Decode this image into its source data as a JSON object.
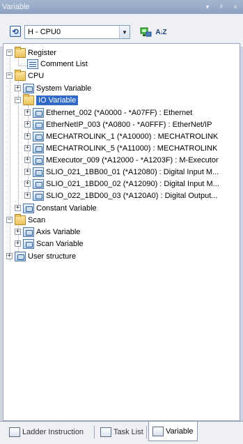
{
  "window": {
    "title": "Variable",
    "pin_glyph": "▾",
    "dock_glyph": "ᵖ",
    "close_glyph": "×"
  },
  "toolbar": {
    "refresh_glyph": "⟲",
    "cpu_select_value": "H - CPU0",
    "dropdown_glyph": "▼",
    "sort_glyph": "A↓Z"
  },
  "tree": {
    "register": "Register",
    "comment_list": "Comment List",
    "cpu": "CPU",
    "system_variable": "System Variable",
    "io_variable": "IO Variable",
    "io_items": [
      "Ethernet_002 (*A0000 - *A07FF) : Ethernet",
      "EtherNetIP_003 (*A0800 - *A0FFF) : EtherNet/IP",
      "MECHATROLINK_1 (*A10000) : MECHATROLINK",
      "MECHATROLINK_5 (*A11000) : MECHATROLINK",
      "MExecutor_009 (*A12000 - *A1203F) : M-Executor",
      "SLIO_021_1BB00_01 (*A12080) : Digital Input M...",
      "SLIO_021_1BD00_02 (*A12090) : Digital Input M...",
      "SLIO_022_1BD00_03 (*A120A0) : Digital Output..."
    ],
    "constant_variable": "Constant Variable",
    "scan": "Scan",
    "axis_variable": "Axis Variable",
    "scan_variable": "Scan Variable",
    "user_structure": "User structure",
    "expand_plus": "+",
    "expand_minus": "−"
  },
  "tabs": [
    {
      "label": "Ladder Instruction"
    },
    {
      "label": "Task List"
    },
    {
      "label": "Variable"
    }
  ]
}
